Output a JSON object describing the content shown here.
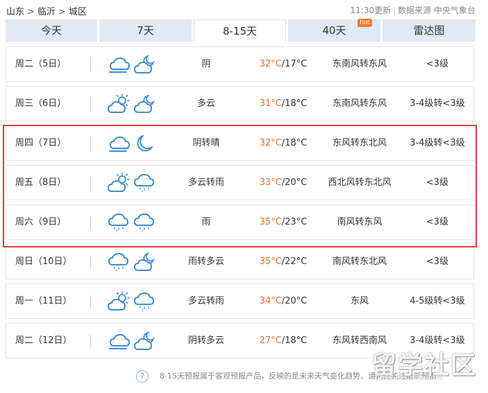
{
  "breadcrumb": {
    "province": "山东",
    "city": "临沂",
    "district": "城区",
    "separator": ">"
  },
  "update": {
    "time": "11:30更新",
    "source": "数据来源 中央气象台"
  },
  "tabs": [
    {
      "label": "今天"
    },
    {
      "label": "7天"
    },
    {
      "label": "8-15天",
      "active": true
    },
    {
      "label": "40天",
      "badge": "hot"
    },
    {
      "label": "雷达图"
    }
  ],
  "rows": [
    {
      "day": "周二（5日）",
      "icon_day": "cloudy-icon",
      "icon_night": "partly-cloudy-night-icon",
      "condition": "阴",
      "high": "32°C",
      "low": "/17°C",
      "wind": "东南风转东风",
      "level": "<3级"
    },
    {
      "day": "周三（6日）",
      "icon_day": "partly-cloudy-day-icon",
      "icon_night": "partly-cloudy-night-icon",
      "condition": "多云",
      "high": "31°C",
      "low": "/18°C",
      "wind": "东南风转东风",
      "level": "3-4级转<3级"
    },
    {
      "day": "周四（7日）",
      "icon_day": "cloudy-icon",
      "icon_night": "moon-icon",
      "condition": "阴转晴",
      "high": "32°C",
      "low": "/18°C",
      "wind": "东风转东北风",
      "level": "3-4级转<3级"
    },
    {
      "day": "周五（8日）",
      "icon_day": "partly-cloudy-day-icon",
      "icon_night": "rain-icon",
      "condition": "多云转雨",
      "high": "33°C",
      "low": "/20°C",
      "wind": "西北风转东北风",
      "level": "<3级"
    },
    {
      "day": "周六（9日）",
      "icon_day": "rain-icon",
      "icon_night": "rain-icon",
      "condition": "雨",
      "high": "35°C",
      "low": "/23°C",
      "wind": "南风转东风",
      "level": "<3级"
    },
    {
      "day": "周日（10日）",
      "icon_day": "rain-icon",
      "icon_night": "partly-cloudy-night-icon",
      "condition": "雨转多云",
      "high": "35°C",
      "low": "/22°C",
      "wind": "南风转东北风",
      "level": "<3级"
    },
    {
      "day": "周一（11日）",
      "icon_day": "partly-cloudy-day-icon",
      "icon_night": "rain-icon",
      "condition": "多云转雨",
      "high": "34°C",
      "low": "/20°C",
      "wind": "东风",
      "level": "4-5级转<3级"
    },
    {
      "day": "周二（12日）",
      "icon_day": "cloudy-icon",
      "icon_night": "partly-cloudy-night-icon",
      "condition": "阴转多云",
      "high": "27°C",
      "low": "/18°C",
      "wind": "东风转西南风",
      "level": "3-4级转<3级"
    }
  ],
  "footer": {
    "help": "?",
    "note": "8-15天预报属于客观预报产品，反映的是未来天气变化趋势，请优先关注最新预报"
  },
  "watermark": {
    "main": "留学社区",
    "sub": "bbs.liuxue86.com"
  },
  "colors": {
    "icon": "#3e8ed0",
    "high_temp": "#e8702a",
    "highlight": "#e03a3a",
    "tab_bg": "#dfeaf4"
  }
}
